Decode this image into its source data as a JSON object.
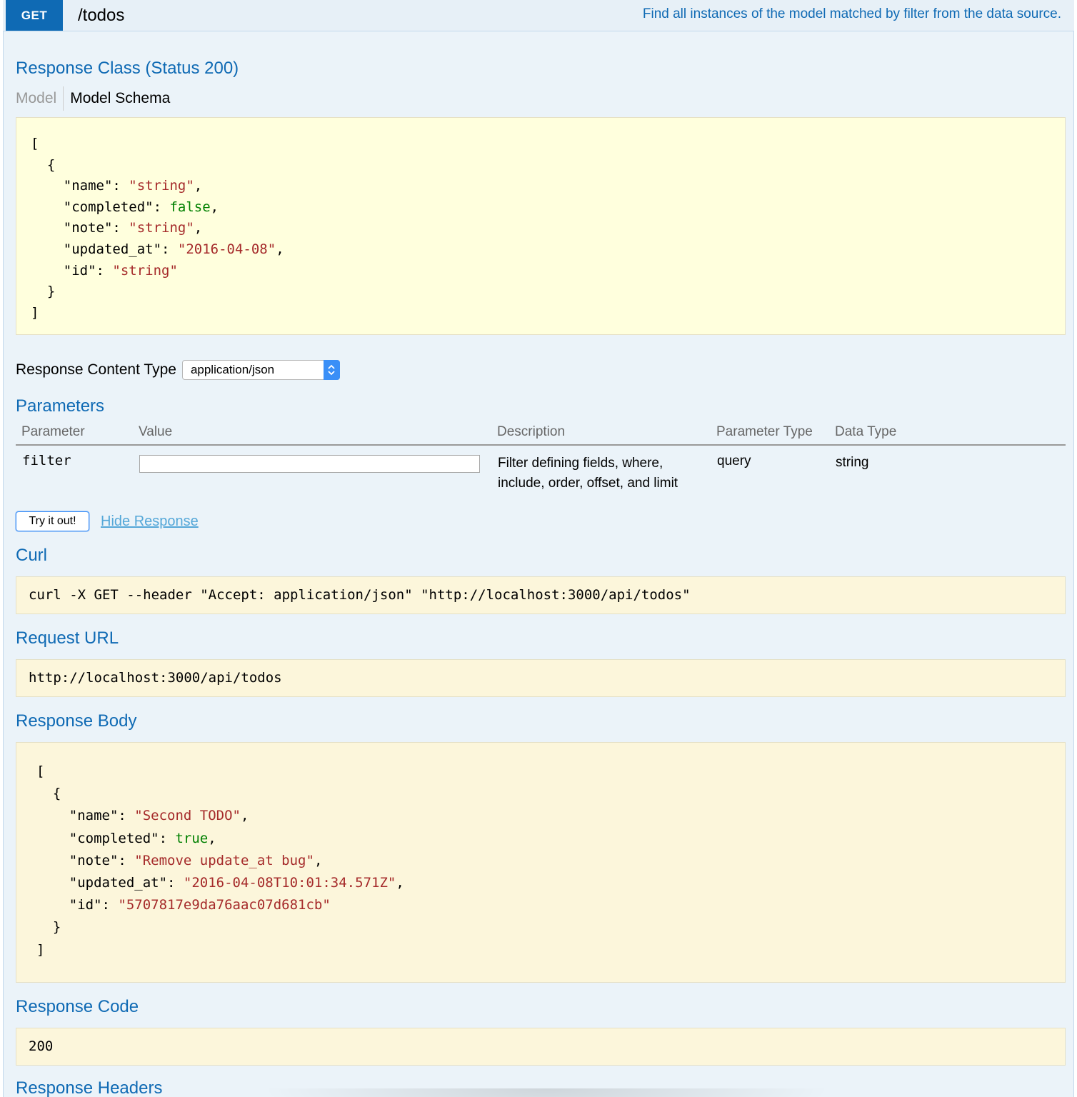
{
  "endpoint": {
    "method": "GET",
    "path": "/todos",
    "summary": "Find all instances of the model matched by filter from the data source."
  },
  "response_class": {
    "title": "Response Class (Status 200)",
    "tabs": {
      "model": "Model",
      "model_schema": "Model Schema"
    },
    "schema_lines": [
      [
        {
          "t": "["
        }
      ],
      [
        {
          "t": "  {"
        }
      ],
      [
        {
          "t": "    \"name\": "
        },
        {
          "t": "\"string\"",
          "c": "str"
        },
        {
          "t": ","
        }
      ],
      [
        {
          "t": "    \"completed\": "
        },
        {
          "t": "false",
          "c": "bool"
        },
        {
          "t": ","
        }
      ],
      [
        {
          "t": "    \"note\": "
        },
        {
          "t": "\"string\"",
          "c": "str"
        },
        {
          "t": ","
        }
      ],
      [
        {
          "t": "    \"updated_at\": "
        },
        {
          "t": "\"2016-04-08\"",
          "c": "str"
        },
        {
          "t": ","
        }
      ],
      [
        {
          "t": "    \"id\": "
        },
        {
          "t": "\"string\"",
          "c": "str"
        }
      ],
      [
        {
          "t": "  }"
        }
      ],
      [
        {
          "t": "]"
        }
      ]
    ]
  },
  "response_content_type": {
    "label": "Response Content Type",
    "selected": "application/json"
  },
  "parameters": {
    "title": "Parameters",
    "headers": {
      "parameter": "Parameter",
      "value": "Value",
      "description": "Description",
      "parameter_type": "Parameter Type",
      "data_type": "Data Type"
    },
    "rows": [
      {
        "name": "filter",
        "value": "",
        "description": "Filter defining fields, where, include, order, offset, and limit",
        "parameter_type": "query",
        "data_type": "string"
      }
    ]
  },
  "actions": {
    "try_label": "Try it out!",
    "hide_label": "Hide Response"
  },
  "curl": {
    "title": "Curl",
    "command": "curl -X GET --header \"Accept: application/json\" \"http://localhost:3000/api/todos\""
  },
  "request_url": {
    "title": "Request URL",
    "value": "http://localhost:3000/api/todos"
  },
  "response_body": {
    "title": "Response Body",
    "lines": [
      [
        {
          "t": "["
        }
      ],
      [
        {
          "t": "  {"
        }
      ],
      [
        {
          "t": "    \"name\": "
        },
        {
          "t": "\"Second TODO\"",
          "c": "str"
        },
        {
          "t": ","
        }
      ],
      [
        {
          "t": "    \"completed\": "
        },
        {
          "t": "true",
          "c": "bool"
        },
        {
          "t": ","
        }
      ],
      [
        {
          "t": "    \"note\": "
        },
        {
          "t": "\"Remove update_at bug\"",
          "c": "str"
        },
        {
          "t": ","
        }
      ],
      [
        {
          "t": "    \"updated_at\": "
        },
        {
          "t": "\"2016-04-08T10:01:34.571Z\"",
          "c": "str"
        },
        {
          "t": ","
        }
      ],
      [
        {
          "t": "    \"id\": "
        },
        {
          "t": "\"5707817e9da76aac07d681cb\"",
          "c": "str"
        }
      ],
      [
        {
          "t": "  }"
        }
      ],
      [
        {
          "t": "]"
        }
      ]
    ]
  },
  "response_code": {
    "title": "Response Code",
    "value": "200"
  },
  "response_headers": {
    "title": "Response Headers"
  },
  "colors": {
    "accent": "#0f6ab4",
    "string": "#a52a2a",
    "boolean": "#008000",
    "schema_bg": "#ffffdd",
    "code_bg": "#fcf6db",
    "panel_bg": "#ebf3f9"
  }
}
